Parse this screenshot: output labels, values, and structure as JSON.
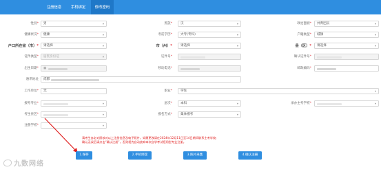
{
  "tabs": [
    {
      "label": "注册信息",
      "active": false
    },
    {
      "label": "手机绑定",
      "active": false
    },
    {
      "label": "修改密码",
      "active": true
    }
  ],
  "form": {
    "gender": {
      "label": "性别",
      "value": "男"
    },
    "ethnicity": {
      "label": "民族",
      "value": "汉"
    },
    "political": {
      "label": "政治面貌",
      "value": "共青团员"
    },
    "health": {
      "label": "健康状况",
      "value": "健康"
    },
    "education": {
      "label": "考前学历",
      "value": "大专(专科)"
    },
    "hukou_type": {
      "label": "户籍类型",
      "value": "城镇"
    },
    "hukou_province": {
      "label": "户口所在省（市）",
      "value": "请选择"
    },
    "hukou_city": {
      "label": "市（州）",
      "value": "请选择"
    },
    "hukou_county": {
      "label": "县（区）",
      "value": "请选择"
    },
    "id_type": {
      "label": "证件类型",
      "value": "居民身份证"
    },
    "id_number": {
      "label": "证件号"
    },
    "id_confirm": {
      "label": "确认证件号"
    },
    "birthday": {
      "label": "出生日期"
    },
    "phone": {
      "label": "移动电话"
    },
    "postcode": {
      "label": "邮政编码"
    },
    "address": {
      "label": "通讯地址",
      "value": "成都"
    },
    "workplace": {
      "label": "工作单位",
      "value": "无"
    },
    "occupation": {
      "label": "职业",
      "value": "学生"
    },
    "major": {
      "label": "报考专业"
    },
    "level": {
      "label": "层次",
      "value": "本科"
    },
    "school": {
      "label": "承办主考学校"
    },
    "exam_city": {
      "label": "考生县区"
    },
    "apply_mode": {
      "label": "报名方式",
      "value": "集体报考"
    },
    "reg_school": {
      "label": "注册学校"
    }
  },
  "notice": {
    "line1": "请考生务必对照核对以上注册信息及电子照片，如需更改请在2024年12月11日至14日期间联系主考学校;",
    "line2": "确认无误后请点击“确认注册”，否则视为自动放弃本次自学考试招用型专业注册。"
  },
  "buttons": {
    "save": "1.保存",
    "bind_phone": "2.手机绑定",
    "upload_photo": "3.照片采集",
    "confirm": "4.确认注册"
  },
  "watermark": "九数网络",
  "colors": {
    "primary": "#2f8ee0",
    "required": "#e0303a",
    "notice": "#e02020"
  }
}
